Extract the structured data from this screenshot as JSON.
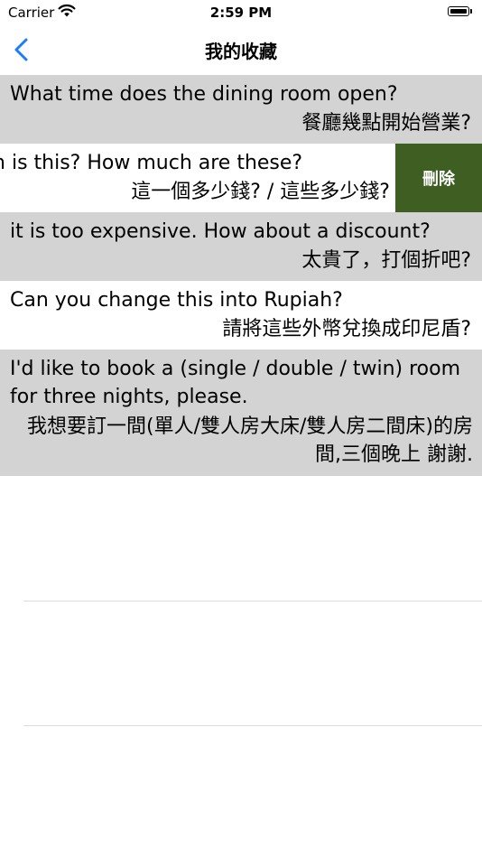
{
  "status": {
    "carrier": "Carrier",
    "time": "2:59 PM"
  },
  "nav": {
    "title": "我的收藏",
    "back_icon": "chevron-left-icon",
    "accent": "#1a7ef5"
  },
  "rows": [
    {
      "en": "What time does the dining room open?",
      "zh": "餐廳幾點開始營業?"
    },
    {
      "en": "uch is this? How much are these?",
      "zh": "這一個多少錢? / 這些多少錢?"
    },
    {
      "en": "it is too expensive. How about a discount?",
      "zh": "太貴了，打個折吧?"
    },
    {
      "en": "Can you change this into Rupiah?",
      "zh": "請將這些外幣兌換成印尼盾?"
    },
    {
      "en": "I'd like to book a (single / double / twin) room for three nights, please.",
      "zh": "我想要訂一間(單人/雙人房大床/雙人房二間床)的房間,三個晚上 謝謝."
    }
  ],
  "delete_label": "刪除",
  "colors": {
    "row_gray": "#d3d3d3",
    "delete_bg": "#3e5e22"
  }
}
